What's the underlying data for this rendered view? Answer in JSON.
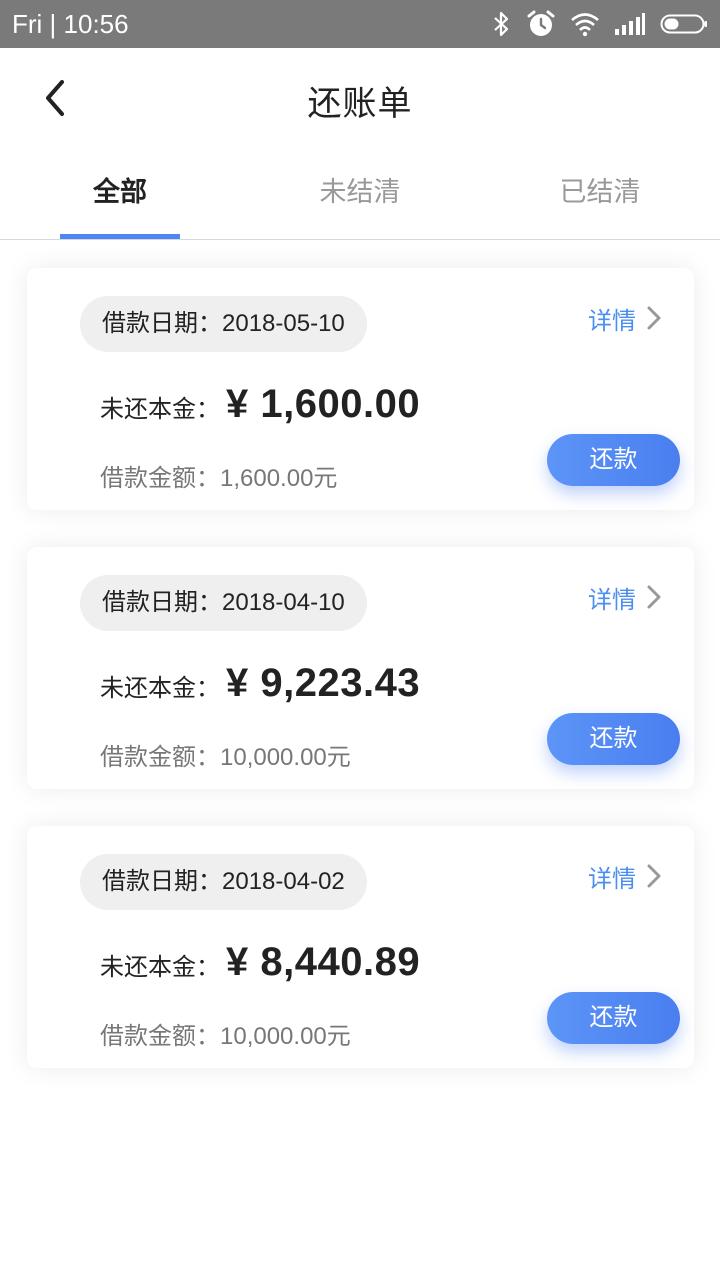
{
  "status_bar": {
    "time": "Fri | 10:56",
    "icons": [
      "bluetooth-icon",
      "alarm-icon",
      "wifi-icon",
      "signal-icon",
      "battery-icon"
    ]
  },
  "header": {
    "title": "还账单",
    "back_icon": "chevron-left-icon"
  },
  "tabs": [
    {
      "label": "全部",
      "active": true
    },
    {
      "label": "未结清",
      "active": false
    },
    {
      "label": "已结清",
      "active": false
    }
  ],
  "colors": {
    "accent": "#4f86f7",
    "link": "#4a8ef0",
    "status_bar": "#7a7a7a"
  },
  "loans": [
    {
      "date_label": "借款日期：",
      "date": "2018-05-10",
      "detail_label": "详情",
      "unpaid_label": "未还本金：",
      "unpaid_amount": "¥ 1,600.00",
      "loan_label": "借款金额：",
      "loan_amount": "1,600.00元",
      "repay_label": "还款"
    },
    {
      "date_label": "借款日期：",
      "date": "2018-04-10",
      "detail_label": "详情",
      "unpaid_label": "未还本金：",
      "unpaid_amount": "¥ 9,223.43",
      "loan_label": "借款金额：",
      "loan_amount": "10,000.00元",
      "repay_label": "还款"
    },
    {
      "date_label": "借款日期：",
      "date": "2018-04-02",
      "detail_label": "详情",
      "unpaid_label": "未还本金：",
      "unpaid_amount": "¥ 8,440.89",
      "loan_label": "借款金额：",
      "loan_amount": "10,000.00元",
      "repay_label": "还款"
    }
  ]
}
